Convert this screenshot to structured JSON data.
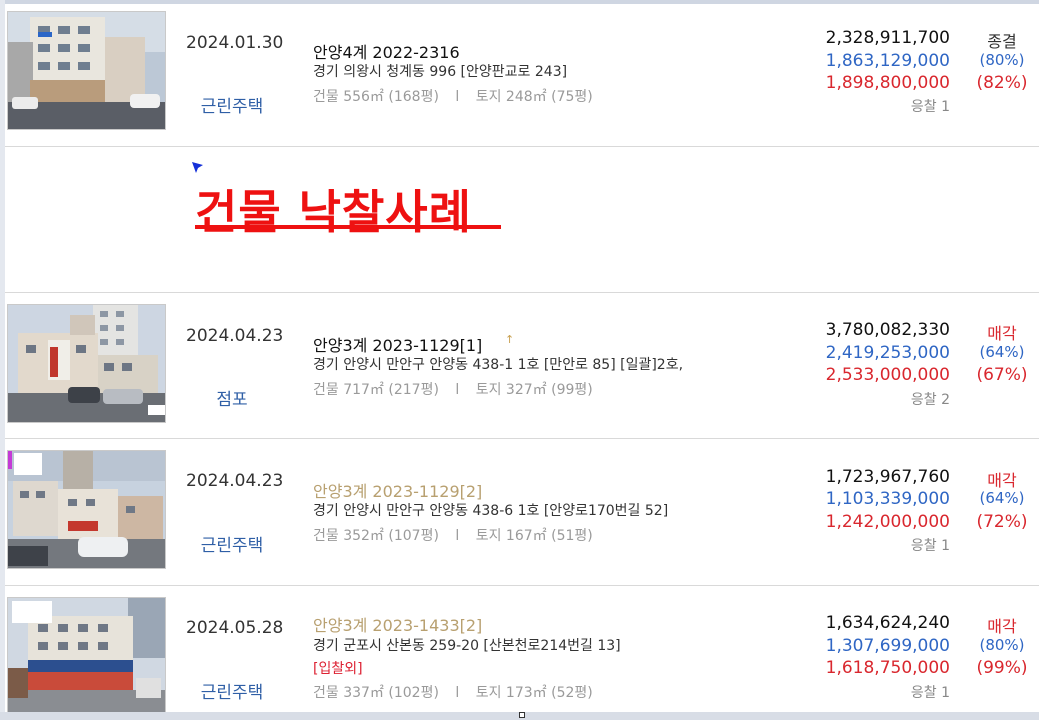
{
  "banner": {
    "title": "건물  낙찰사례"
  },
  "rows": [
    {
      "date": "2024.01.30",
      "kind": "근린주택",
      "case": "안양4계 2022-2316",
      "address": "경기 의왕시 청계동 996 [안양판교로 243]",
      "area_building": "건물 556㎡ (168평)",
      "area_land": "토지 248㎡ (75평)",
      "appraisal": "2,328,911,700",
      "minimum": "1,863,129,000",
      "sold": "1,898,800,000",
      "bid_count": "응찰 1",
      "status": "종결",
      "min_pct": "(80%)",
      "sold_pct": "(82%)"
    },
    {
      "date": "2024.04.23",
      "kind": "점포",
      "case": "안양3계 2023-1129[1]",
      "address": "경기 안양시 만안구 안양동 438-1 1호 [만안로 85]  [일괄]2호,",
      "area_building": "건물 717㎡ (217평)",
      "area_land": "토지 327㎡ (99평)",
      "appraisal": "3,780,082,330",
      "minimum": "2,419,253,000",
      "sold": "2,533,000,000",
      "bid_count": "응찰 2",
      "status": "매각",
      "min_pct": "(64%)",
      "sold_pct": "(67%)"
    },
    {
      "date": "2024.04.23",
      "kind": "근린주택",
      "case": "안양3계 2023-1129[2]",
      "address": "경기 안양시 만안구 안양동 438-6 1호 [안양로170번길 52]",
      "area_building": "건물 352㎡ (107평)",
      "area_land": "토지 167㎡ (51평)",
      "appraisal": "1,723,967,760",
      "minimum": "1,103,339,000",
      "sold": "1,242,000,000",
      "bid_count": "응찰 1",
      "status": "매각",
      "min_pct": "(64%)",
      "sold_pct": "(72%)"
    },
    {
      "date": "2024.05.28",
      "kind": "근린주택",
      "case": "안양3계 2023-1433[2]",
      "address": "경기 군포시 산본동 259-20 [산본천로214번길 13]",
      "note": "[입찰외]",
      "area_building": "건물 337㎡ (102평)",
      "area_land": "토지 173㎡ (52평)",
      "appraisal": "1,634,624,240",
      "minimum": "1,307,699,000",
      "sold": "1,618,750,000",
      "bid_count": "응찰 1",
      "status": "매각",
      "min_pct": "(80%)",
      "sold_pct": "(99%)"
    }
  ],
  "separator": "l",
  "colors": {
    "blue": "#2f66c4",
    "red": "#d9272e",
    "gold": "#b8a070",
    "kind": "#2f5fa6"
  }
}
